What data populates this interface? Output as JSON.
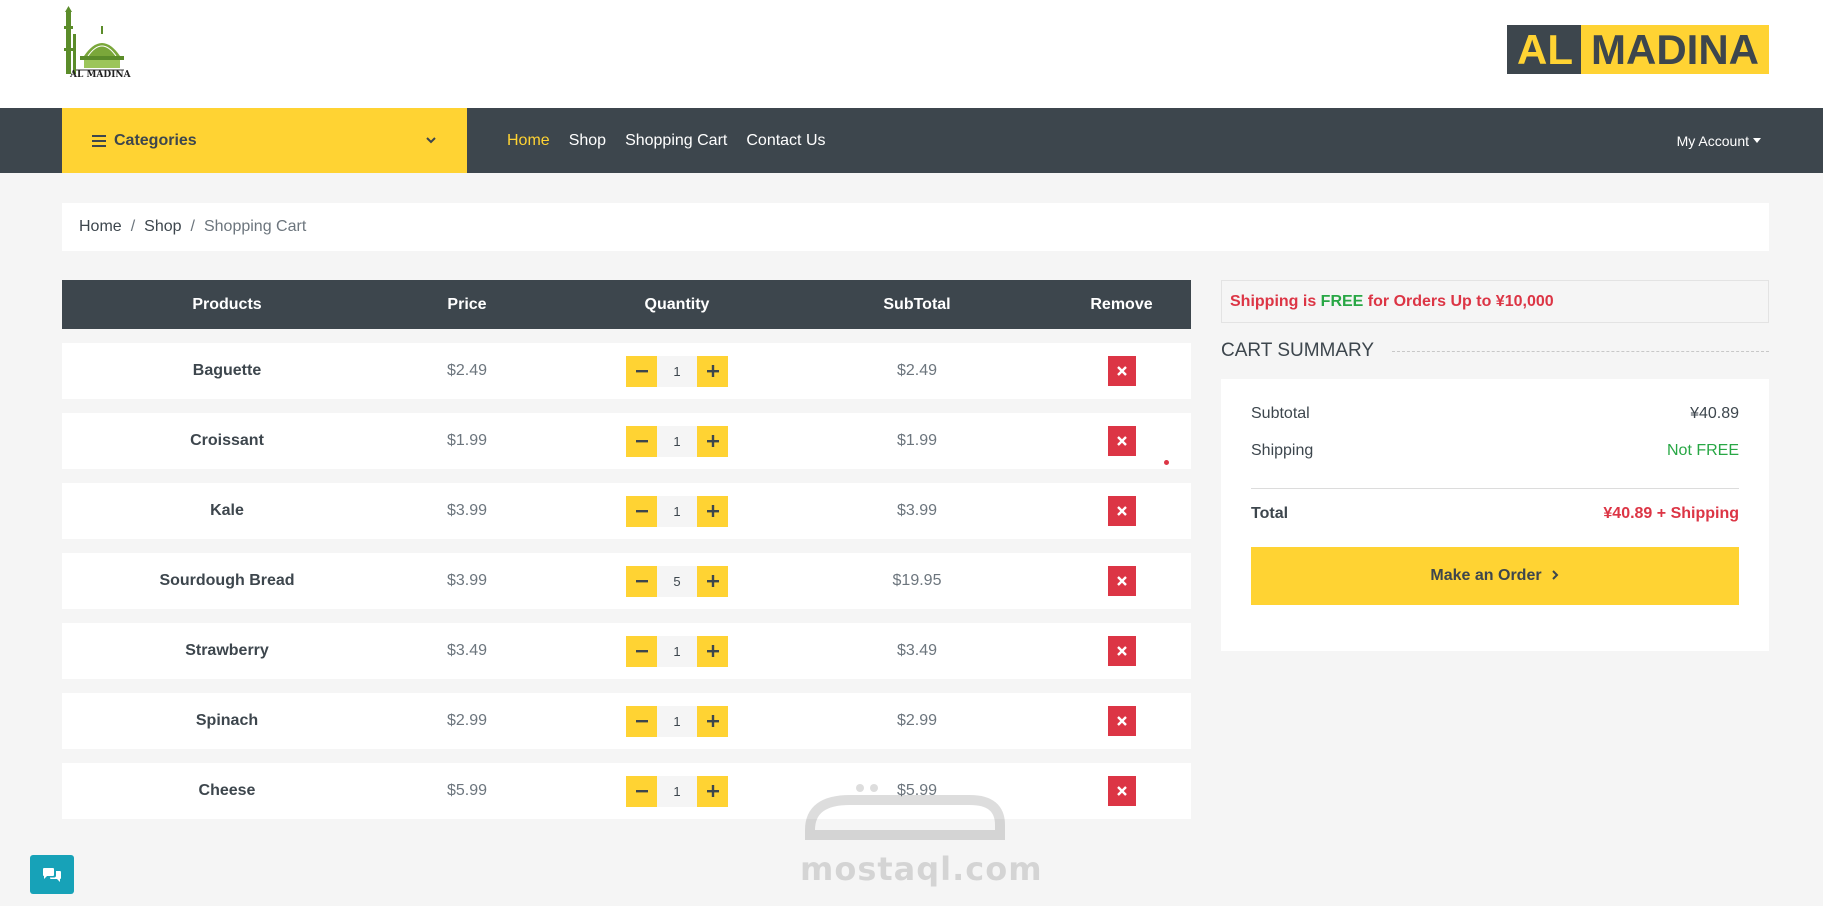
{
  "brand": {
    "logo_text": "AL MADINA",
    "badge_left": "AL",
    "badge_right": "MADINA"
  },
  "nav": {
    "categories_label": "Categories",
    "links": [
      {
        "label": "Home",
        "active": true
      },
      {
        "label": "Shop",
        "active": false
      },
      {
        "label": "Shopping Cart",
        "active": false
      },
      {
        "label": "Contact Us",
        "active": false
      }
    ],
    "account_label": "My Account"
  },
  "breadcrumb": {
    "items": [
      "Home",
      "Shop"
    ],
    "current": "Shopping Cart",
    "separator": "/"
  },
  "cart": {
    "headers": [
      "Products",
      "Price",
      "Quantity",
      "SubTotal",
      "Remove"
    ],
    "rows": [
      {
        "name": "Baguette",
        "price": "$2.49",
        "qty": "1",
        "subtotal": "$2.49"
      },
      {
        "name": "Croissant",
        "price": "$1.99",
        "qty": "1",
        "subtotal": "$1.99"
      },
      {
        "name": "Kale",
        "price": "$3.99",
        "qty": "1",
        "subtotal": "$3.99"
      },
      {
        "name": "Sourdough Bread",
        "price": "$3.99",
        "qty": "5",
        "subtotal": "$19.95"
      },
      {
        "name": "Strawberry",
        "price": "$3.49",
        "qty": "1",
        "subtotal": "$3.49"
      },
      {
        "name": "Spinach",
        "price": "$2.99",
        "qty": "1",
        "subtotal": "$2.99"
      },
      {
        "name": "Cheese",
        "price": "$5.99",
        "qty": "1",
        "subtotal": "$5.99"
      }
    ]
  },
  "shipping_note": {
    "prefix": "Shipping is ",
    "free": "FREE",
    "suffix": "for Orders Up to ¥10,000"
  },
  "summary": {
    "title": "CART SUMMARY",
    "subtotal_label": "Subtotal",
    "subtotal_value": "¥40.89",
    "shipping_label": "Shipping",
    "shipping_value": "Not FREE",
    "total_label": "Total",
    "total_value": "¥40.89 + Shipping",
    "order_button": "Make an Order"
  },
  "watermark": {
    "text": "mostaql.com"
  },
  "colors": {
    "accent": "#ffd333",
    "dark": "#3d464d",
    "danger": "#dc3545",
    "success": "#28a745",
    "chat": "#17a2b8"
  }
}
